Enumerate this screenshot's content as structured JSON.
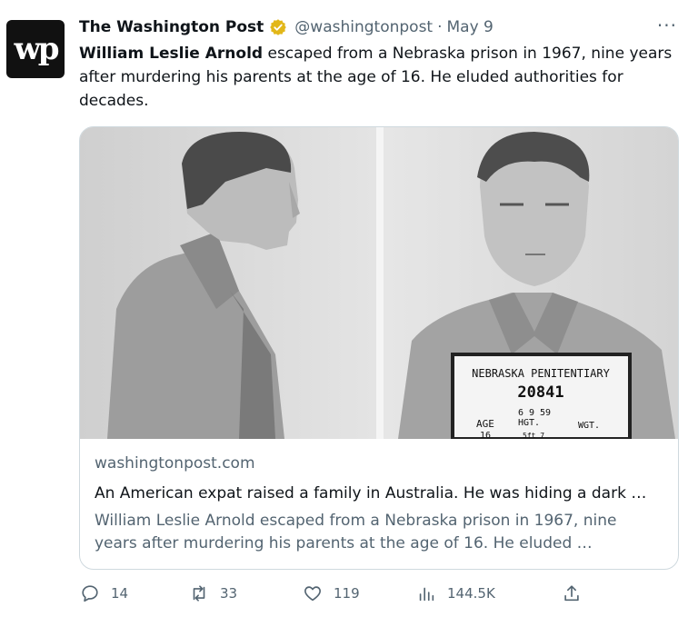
{
  "tweet": {
    "author_name": "The Washington Post",
    "handle": "@washingtonpost",
    "separator": "·",
    "date": "May 9",
    "avatar_text": "wp",
    "text_bold": "William Leslie Arnold",
    "text_rest": " escaped from a Nebraska prison in 1967, nine years after murdering his parents at the age of 16. He eluded authorities for decades."
  },
  "card": {
    "domain": "washingtonpost.com",
    "title": "An American expat raised a family in Australia. He was hiding a dark …",
    "description": "William Leslie Arnold escaped from a Nebraska prison in 1967, nine years after murdering his parents at the age of 16. He eluded …",
    "mugshot_sign": {
      "institution": "NEBRASKA PENITENTIARY",
      "number": "20841",
      "date": "6 9 59",
      "age_label": "AGE",
      "age": "16",
      "height_label": "HGT.",
      "height": "5ft 7",
      "weight_label": "WGT."
    }
  },
  "actions": {
    "replies": "14",
    "reposts": "33",
    "likes": "119",
    "views": "144.5K"
  },
  "icons": [
    "verified-badge-icon",
    "more-icon",
    "reply-icon",
    "repost-icon",
    "like-icon",
    "views-icon",
    "share-icon"
  ],
  "colors": {
    "text": "#0f1419",
    "secondary": "#536471",
    "verified_gold": "#e2b719",
    "border": "#cfd9de"
  }
}
